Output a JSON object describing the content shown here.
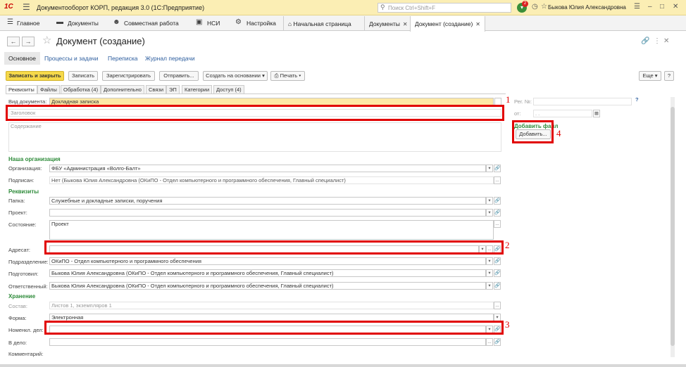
{
  "titlebar": {
    "logo": "1С",
    "title": "Документооборот КОРП, редакция 3.0  (1С:Предприятие)",
    "search_placeholder": "Поиск Ctrl+Shift+F",
    "notif_count": "2",
    "user": "Быкова Юлия Александровна"
  },
  "sections": [
    {
      "label": "Главное"
    },
    {
      "label": "Документы"
    },
    {
      "label": "Совместная работа"
    },
    {
      "label": "НСИ"
    },
    {
      "label": "Настройка"
    }
  ],
  "open_tabs": [
    {
      "label": "Начальная страница"
    },
    {
      "label": "Документы"
    },
    {
      "label": "Документ (создание)"
    }
  ],
  "doc": {
    "title": "Документ (создание)",
    "nav": [
      "Основное",
      "Процессы и задачи",
      "Переписка",
      "Журнал передачи"
    ]
  },
  "toolbar": {
    "save_close": "Записать и закрыть",
    "save": "Записать",
    "register": "Зарегистрировать",
    "send": "Отправить...",
    "create_based": "Создать на основании",
    "print": "Печать",
    "more": "Еще",
    "help": "?"
  },
  "form_tabs": [
    "Реквизиты",
    "Файлы",
    "Обработка (4)",
    "Дополнительно",
    "Связи",
    "ЭП",
    "Категории",
    "Доступ (4)"
  ],
  "form": {
    "doc_kind_label": "Вид документа:",
    "doc_kind_value": "Докладная записка",
    "header_placeholder": "Заголовок",
    "content_placeholder": "Содержание",
    "reg_no_label": "Рег. №:",
    "from_label": "от:",
    "date_value": ". .",
    "add_file_title": "Добавить файл",
    "add_file_button": "Добавить...",
    "org_section": "Наша организация",
    "org_label": "Организация:",
    "org_value": "ФБУ «Администрация «Волго-Балт»",
    "signed_label": "Подписан:",
    "signed_value": "Нет (Быкова Юлия Александровна (ОКиПО - Отдел компьютерного и программного обеспечения, Главный специалист)",
    "req_section": "Реквизиты",
    "folder_label": "Папка:",
    "folder_value": "Служебные и докладные записки, поручения",
    "project_label": "Проект:",
    "state_label": "Состояние:",
    "state_value": "Проект",
    "addressee_label": "Адресат:",
    "dept_label": "Подразделение:",
    "dept_value": "ОКиПО - Отдел компьютерного и программного обеспечения",
    "prepared_label": "Подготовил:",
    "prepared_value": "Быкова Юлия Александровна (ОКиПО - Отдел компьютерного и программного обеспечения, Главный специалист)",
    "responsible_label": "Ответственный:",
    "responsible_value": "Быкова Юлия Александровна (ОКиПО - Отдел компьютерного и программного обеспечения, Главный специалист)",
    "storage_section": "Хранение",
    "composition_label": "Состав:",
    "composition_value": "Листов 1, экземпляров 1",
    "form_label": "Форма:",
    "form_value": "Электронная",
    "nomen_label": "Номенкл. дел:",
    "todo_label": "В дело:",
    "comment_label": "Комментарий:"
  },
  "annotations": {
    "a1": "1",
    "a2": "2",
    "a3": "3",
    "a4": "4"
  }
}
